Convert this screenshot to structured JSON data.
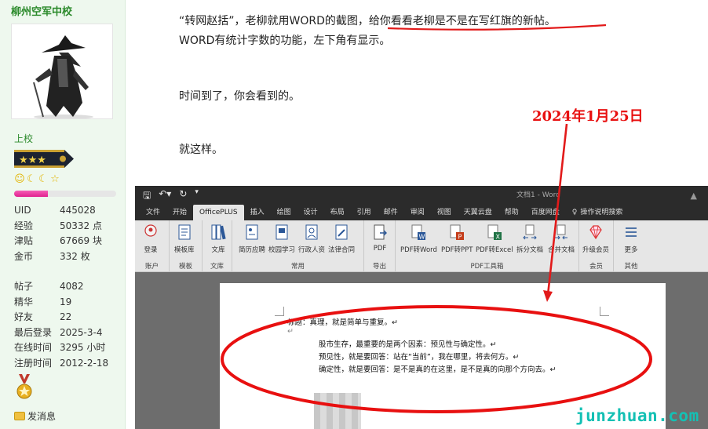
{
  "profile": {
    "username": "柳州空军中校",
    "rank": "上校",
    "progress_fraction": 0.33,
    "stats": [
      {
        "k": "UID",
        "v": "445028"
      },
      {
        "k": "经验",
        "v": "50332 点"
      },
      {
        "k": "津贴",
        "v": "67669 块"
      },
      {
        "k": "金币",
        "v": "332 枚"
      }
    ],
    "stats2": [
      {
        "k": "帖子",
        "v": "4082"
      },
      {
        "k": "精华",
        "v": "19"
      },
      {
        "k": "好友",
        "v": "22"
      },
      {
        "k": "最后登录",
        "v": "2025-3-4"
      },
      {
        "k": "在线时间",
        "v": "3295 小时"
      },
      {
        "k": "注册时间",
        "v": "2012-2-18"
      }
    ],
    "message_label": "发消息"
  },
  "post": {
    "line1_a": "“转网赵括”，老柳就用WORD的截图，",
    "line1_b": "给你看看老柳是不是在写红旗的新帖。",
    "line2": "WORD有统计字数的功能，左下角有显示。",
    "line3": "时间到了，你会看到的。",
    "line4": "就这样。",
    "date_annotation": "2024年1月25日"
  },
  "word": {
    "doc_title": "文档1 - Word",
    "tabs": [
      "文件",
      "开始",
      "OfficePLUS",
      "插入",
      "绘图",
      "设计",
      "布局",
      "引用",
      "邮件",
      "审阅",
      "视图",
      "天翼云盘",
      "帮助",
      "百度网盘"
    ],
    "help_label": "操作说明搜索",
    "ribbon": {
      "login": "登录",
      "account": "账户",
      "template_lib": "模板库",
      "template": "模板",
      "library": "文库",
      "library_group": "文库",
      "resume": "简历应聘",
      "school": "校园学习",
      "hr": "行政人资",
      "legal": "法律合同",
      "common": "常用",
      "pdf": "PDF",
      "export": "导出",
      "pdf2word": "PDF转Word",
      "pdf2ppt": "PDF转PPT",
      "pdf2excel": "PDF转Excel",
      "split": "拆分文档",
      "merge": "合并文档",
      "pdf_tools": "PDF工具箱",
      "upgrade": "升级会员",
      "member": "会员",
      "more": "更多",
      "other": "其他"
    },
    "doc_lines": {
      "title": "标题：真理，就是简单与重复。↵",
      "blank": "↵",
      "l1": "股市生存，最重要的是两个因素：预见性与确定性。↵",
      "l2": "预见性，就是要回答：站在“当前”，我在哪里，将去何方。↵",
      "l3": "确定性，就是要回答：是不是真的在这里，是不是真的向那个方向去。↵"
    }
  },
  "watermark": "junzhuan.com"
}
